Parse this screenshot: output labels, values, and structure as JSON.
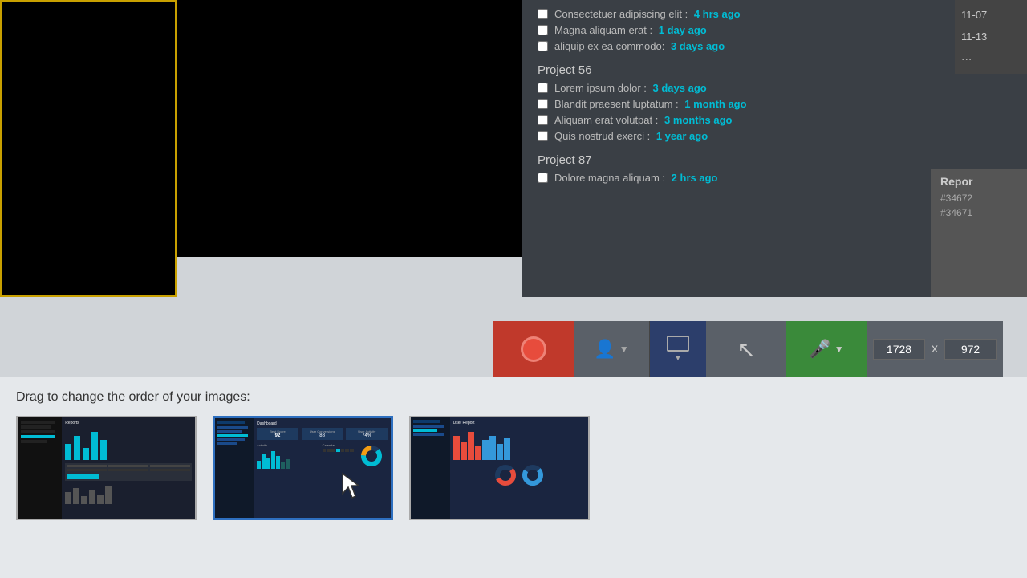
{
  "top": {
    "projects": [
      {
        "title": "Project 56",
        "items": [
          {
            "text": "Lorem ipsum dolor :",
            "time": "3 days ago"
          },
          {
            "text": "Blandit praesent luptatum :",
            "time": "1 month ago"
          },
          {
            "text": "Aliquam erat volutpat :",
            "time": "3 months ago"
          },
          {
            "text": "Quis nostrud exerci :",
            "time": "1 year ago"
          }
        ]
      },
      {
        "title": "Project 87",
        "items": [
          {
            "text": "Dolore magna aliquam :",
            "time": "2 hrs ago"
          }
        ]
      }
    ],
    "extra_items": [
      {
        "text": "Consectetuer adipiscing elit :",
        "time": "4 hrs ago"
      },
      {
        "text": "Magna aliquam erat :",
        "time": "1 day ago"
      },
      {
        "text": "aliquip ex ea commodo:",
        "time": "3 days ago"
      }
    ],
    "numbers": [
      "11-07",
      "11-13",
      "..."
    ],
    "report_label": "Repor",
    "report_ids": [
      "#34672",
      "#34671"
    ]
  },
  "toolbar": {
    "record_title": "record",
    "user_icon": "👤",
    "width": "1728",
    "height": "972",
    "x_label": "x"
  },
  "bottom": {
    "drag_label": "Drag to change the order of your images:",
    "thumbnails": [
      {
        "label": "Reports",
        "selected": false
      },
      {
        "label": "Dashboard",
        "selected": true
      },
      {
        "label": "User Report",
        "selected": false
      }
    ]
  }
}
